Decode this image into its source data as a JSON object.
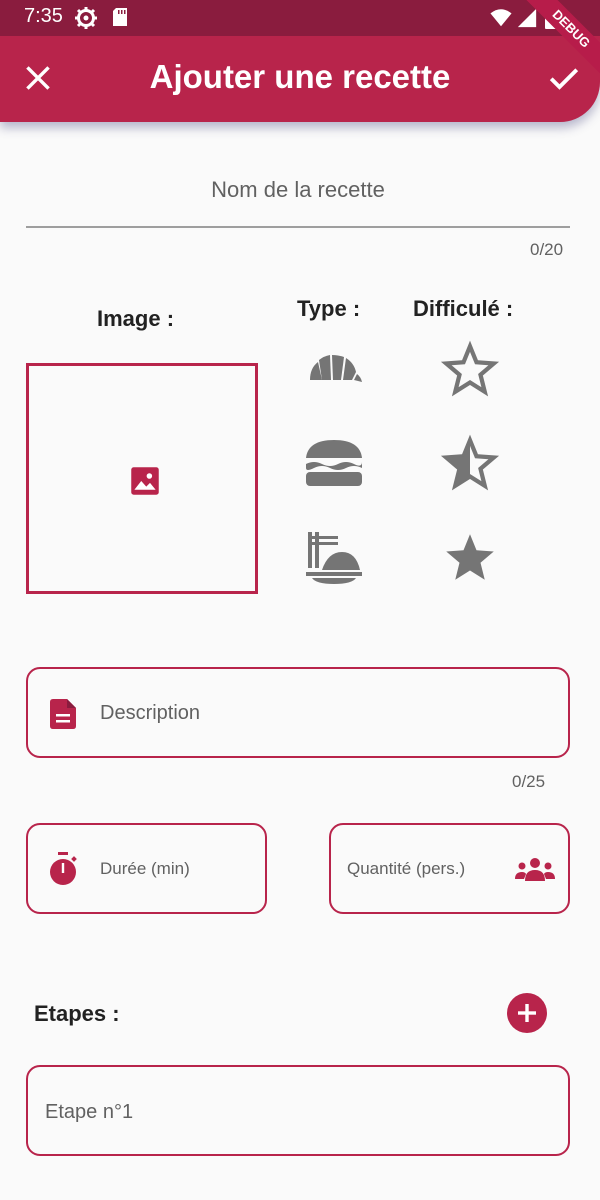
{
  "status_bar": {
    "time": "7:35",
    "icons": [
      "gear-icon",
      "sd-card-icon",
      "wifi-icon",
      "signal-icon",
      "battery-icon"
    ]
  },
  "debug_banner": "DEBUG",
  "app_bar": {
    "title": "Ajouter une recette",
    "close_icon": "close-icon",
    "confirm_icon": "check-icon",
    "color": "#B8244B"
  },
  "form": {
    "name": {
      "placeholder": "Nom de la recette",
      "value": "",
      "counter": "0/20"
    },
    "image": {
      "label": "Image :",
      "icon": "image-icon"
    },
    "type": {
      "label": "Type :",
      "options": [
        "croissant-icon",
        "burger-icon",
        "dish-icon"
      ]
    },
    "difficulty": {
      "label": "Difficulé :",
      "options": [
        "star-outline-icon",
        "star-half-icon",
        "star-full-icon"
      ]
    },
    "description": {
      "placeholder": "Description",
      "value": "",
      "counter": "0/25",
      "icon": "document-icon"
    },
    "duration": {
      "placeholder": "Durée (min)",
      "value": "",
      "icon": "timer-icon"
    },
    "quantity": {
      "placeholder": "Quantité (pers.)",
      "value": "",
      "icon": "people-icon"
    },
    "steps": {
      "label": "Etapes :",
      "add_icon": "add-circle-icon",
      "items": [
        {
          "placeholder": "Etape n°1",
          "value": ""
        }
      ]
    }
  },
  "colors": {
    "accent": "#B8244B",
    "status_bar": "#8A1C3E",
    "icon_grey": "#757575",
    "background": "#FAFAFA"
  }
}
